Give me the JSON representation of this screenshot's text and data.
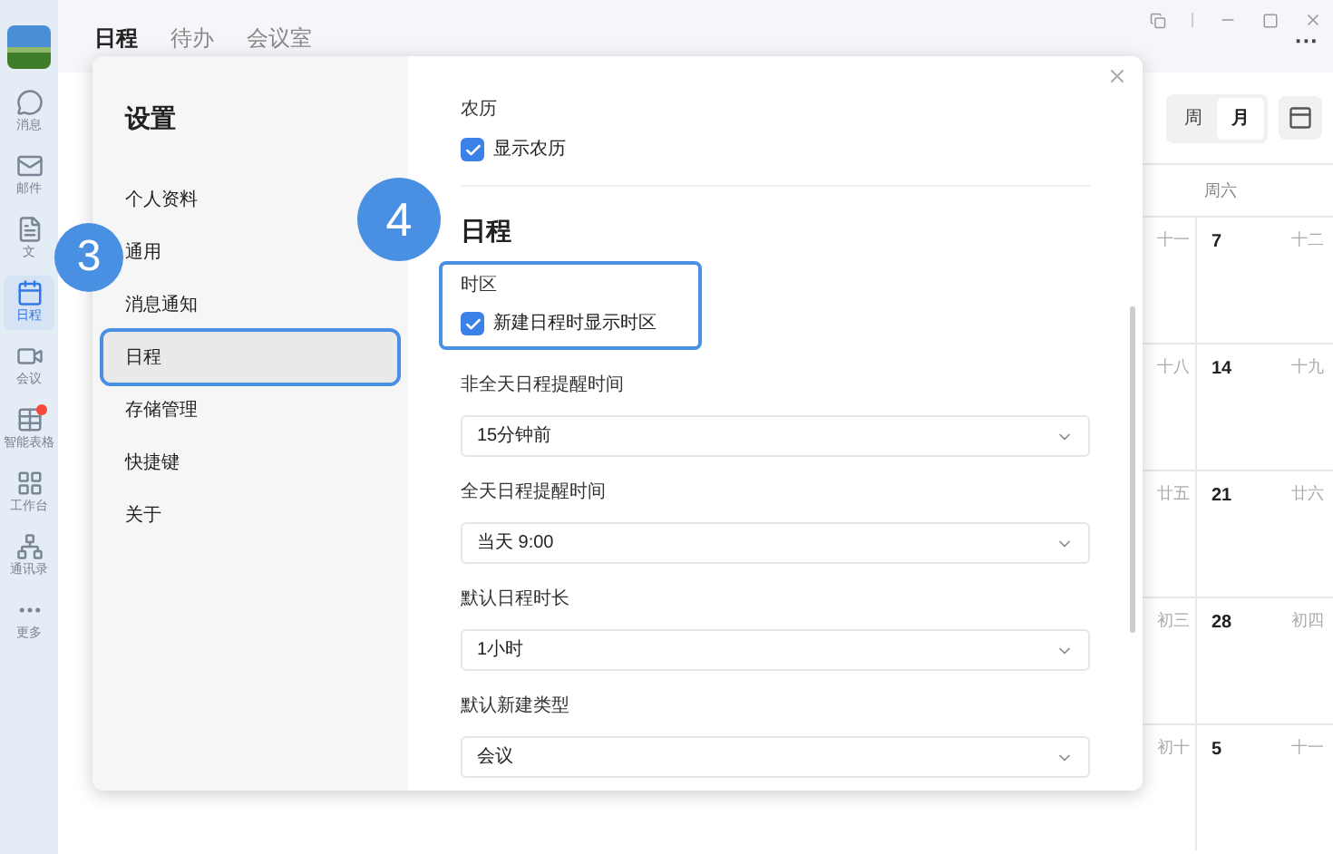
{
  "window_controls": {
    "more": "···"
  },
  "rail": [
    {
      "label": "消息",
      "selected": false,
      "badge": false
    },
    {
      "label": "邮件",
      "selected": false,
      "badge": false
    },
    {
      "label": "文",
      "selected": false,
      "badge": false
    },
    {
      "label": "日程",
      "selected": true,
      "badge": false
    },
    {
      "label": "会议",
      "selected": false,
      "badge": false
    },
    {
      "label": "智能表格",
      "selected": false,
      "badge": true
    },
    {
      "label": "工作台",
      "selected": false,
      "badge": false
    },
    {
      "label": "通讯录",
      "selected": false,
      "badge": false
    },
    {
      "label": "更多",
      "selected": false,
      "badge": false
    }
  ],
  "tabs": [
    {
      "label": "日程",
      "selected": true
    },
    {
      "label": "待办",
      "selected": false
    },
    {
      "label": "会议室",
      "selected": false
    }
  ],
  "calendar": {
    "views": [
      {
        "label": "周",
        "selected": false
      },
      {
        "label": "月",
        "selected": true
      }
    ],
    "weekday": "周六",
    "rows": [
      {
        "lunar_left": "十一",
        "date": "7",
        "lunar_right": "十二"
      },
      {
        "lunar_left": "十八",
        "date": "14",
        "lunar_right": "十九"
      },
      {
        "lunar_left": "廿五",
        "date": "21",
        "lunar_right": "廿六"
      },
      {
        "lunar_left": "初三",
        "date": "28",
        "lunar_right": "初四"
      },
      {
        "lunar_left": "初十",
        "date": "5",
        "lunar_right": "十一"
      }
    ]
  },
  "settings": {
    "title": "设置",
    "nav": [
      {
        "label": "个人资料",
        "selected": false
      },
      {
        "label": "通用",
        "selected": false
      },
      {
        "label": "消息通知",
        "selected": false
      },
      {
        "label": "日程",
        "selected": true
      },
      {
        "label": "存储管理",
        "selected": false
      },
      {
        "label": "快捷键",
        "selected": false
      },
      {
        "label": "关于",
        "selected": false
      }
    ],
    "lunar": {
      "label": "农历",
      "checkbox": {
        "label": "显示农历",
        "checked": true
      }
    },
    "section_title": "日程",
    "timezone": {
      "label": "时区",
      "checkbox": {
        "label": "新建日程时显示时区",
        "checked": true
      }
    },
    "selects": [
      {
        "label": "非全天日程提醒时间",
        "value": "15分钟前"
      },
      {
        "label": "全天日程提醒时间",
        "value": "当天 9:00"
      },
      {
        "label": "默认日程时长",
        "value": "1小时"
      },
      {
        "label": "默认新建类型",
        "value": "会议"
      }
    ]
  },
  "callouts": [
    {
      "number": "3"
    },
    {
      "number": "4"
    }
  ]
}
